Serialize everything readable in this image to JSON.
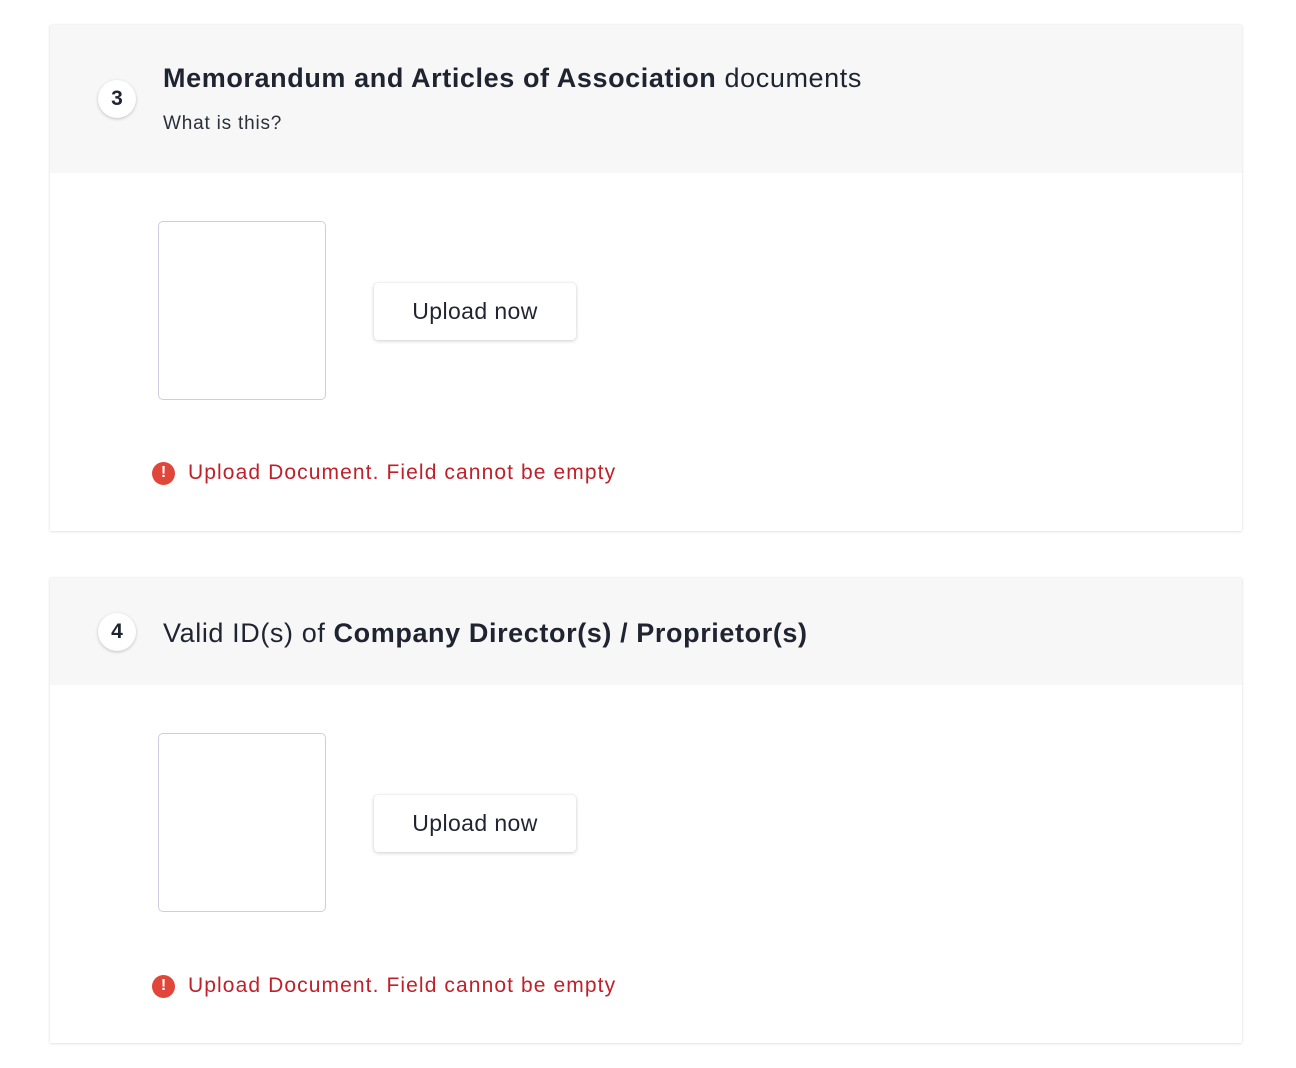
{
  "sections": [
    {
      "step_number": "3",
      "title_bold": "Memorandum and Articles of Association",
      "title_regular_suffix": " documents",
      "help_link": "What is this?",
      "upload_button_label": "Upload now",
      "error_icon_glyph": "!",
      "error_message": "Upload Document. Field cannot be empty"
    },
    {
      "step_number": "4",
      "title_regular_prefix": "Valid ID(s) of ",
      "title_bold": "Company Director(s) / Proprietor(s)",
      "upload_button_label": "Upload now",
      "error_icon_glyph": "!",
      "error_message": "Upload Document. Field cannot be empty"
    }
  ],
  "colors": {
    "header_background": "#f7f7f8",
    "error_text": "#c0202a",
    "error_icon": "#e0463a",
    "preview_border": "#cfcde3",
    "text_primary": "#1f2430"
  },
  "icons": {
    "error": "exclamation-circle-icon"
  }
}
